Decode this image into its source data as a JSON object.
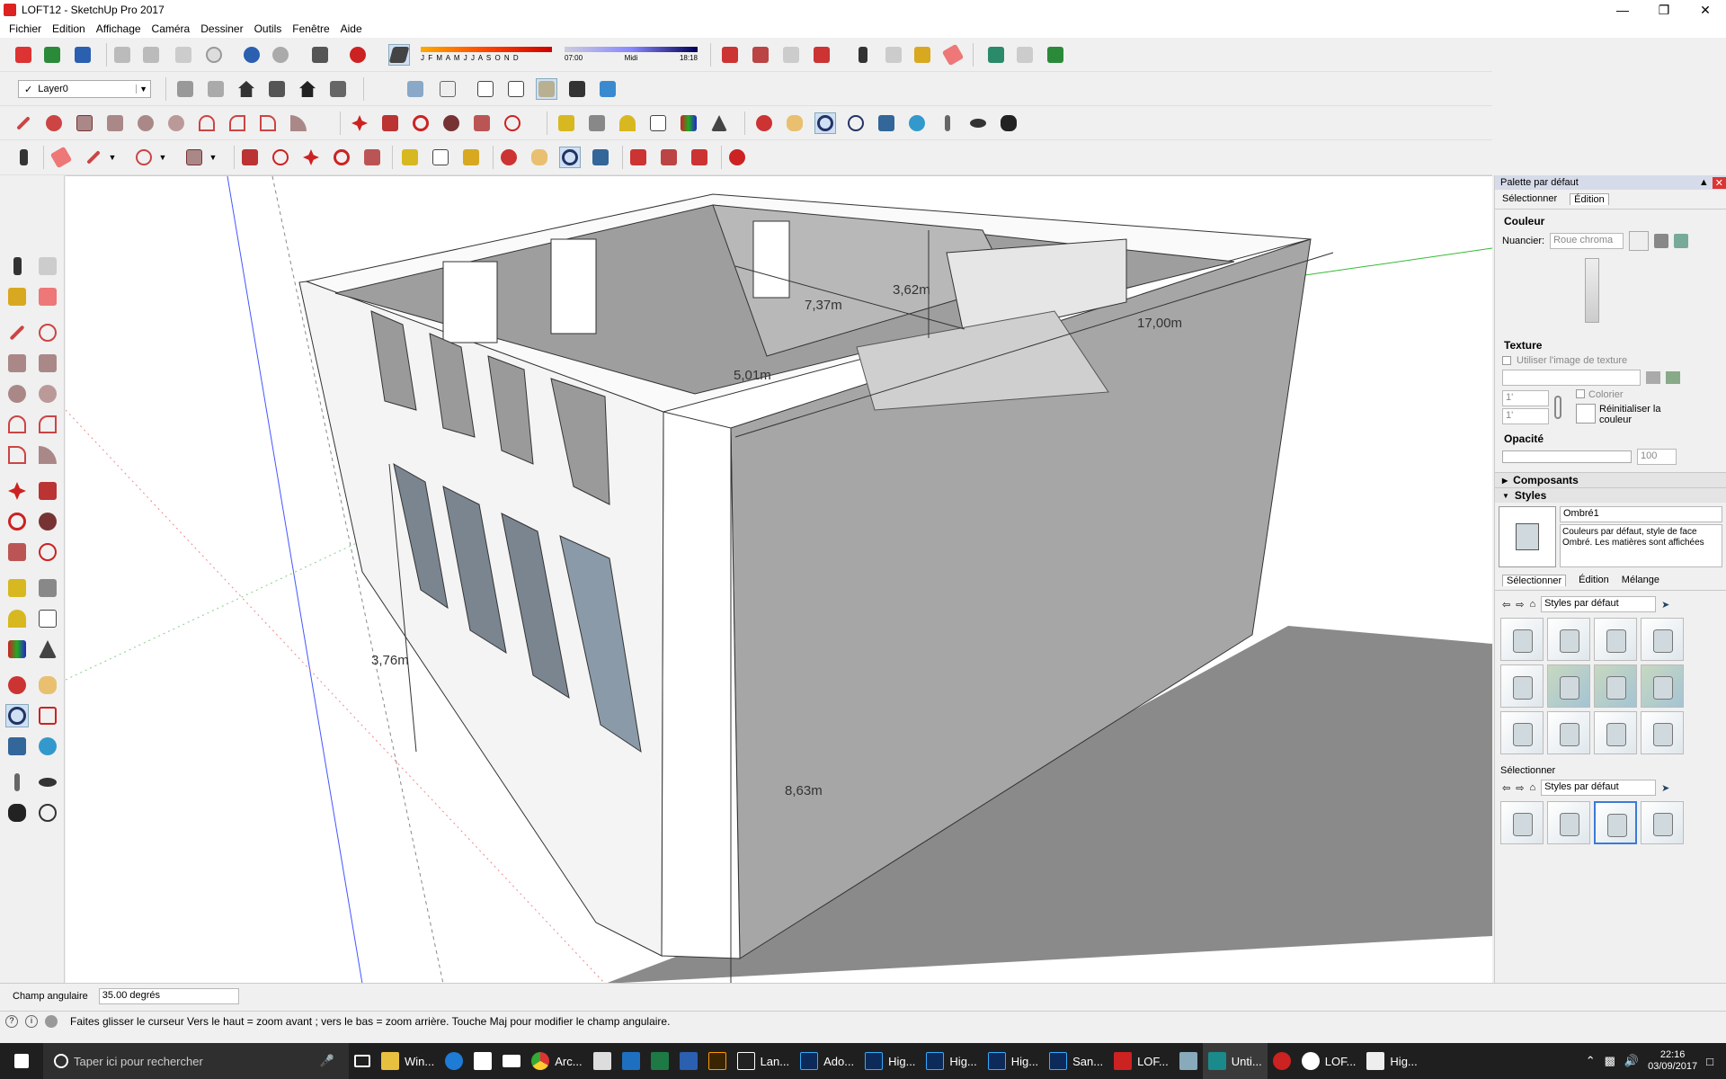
{
  "window": {
    "title": "LOFT12 - SketchUp Pro 2017"
  },
  "menu": [
    "Fichier",
    "Edition",
    "Affichage",
    "Caméra",
    "Dessiner",
    "Outils",
    "Fenêtre",
    "Aide"
  ],
  "shadow": {
    "months": "J F M A M J J A S O N D",
    "time_start": "07:00",
    "time_mid": "Midi",
    "time_end": "18:18"
  },
  "layer": {
    "value": "Layer0"
  },
  "dimensions": [
    "7,37m",
    "3,62m",
    "17,00m",
    "5,01m",
    "3,76m",
    "8,63m"
  ],
  "panel": {
    "title": "Palette par défaut",
    "tabs": [
      "Sélectionner",
      "Édition"
    ],
    "couleur": {
      "label": "Couleur",
      "nuancier_label": "Nuancier:",
      "nuancier_value": "Roue chroma"
    },
    "texture": {
      "label": "Texture",
      "use_texture": "Utiliser l'image de texture",
      "w": "1'",
      "h": "1'",
      "colorier": "Colorier",
      "reset": "Réinitialiser la couleur"
    },
    "opacite": {
      "label": "Opacité",
      "value": "100"
    },
    "composants": "Composants",
    "styles": {
      "label": "Styles",
      "name": "Ombré1",
      "desc": "Couleurs par défaut, style de face Ombré. Les matières sont affichées",
      "tabs": [
        "Sélectionner",
        "Édition",
        "Mélange"
      ],
      "collection": "Styles par défaut",
      "select_label": "Sélectionner",
      "collection2": "Styles par défaut"
    }
  },
  "status": {
    "measure_label": "Champ angulaire",
    "measure_value": "35.00 degrés",
    "hint": "Faites glisser le curseur  Vers le haut = zoom avant ; vers le bas = zoom arrière. Touche Maj pour modifier le champ angulaire."
  },
  "taskbar": {
    "search": "Taper ici pour rechercher",
    "items": [
      "Win...",
      "Arc...",
      "Lan...",
      "Ado...",
      "Hig...",
      "Hig...",
      "Hig...",
      "San...",
      "LOF...",
      "Unti...",
      "LOF...",
      "Hig..."
    ],
    "time": "22:16",
    "date": "03/09/2017"
  }
}
